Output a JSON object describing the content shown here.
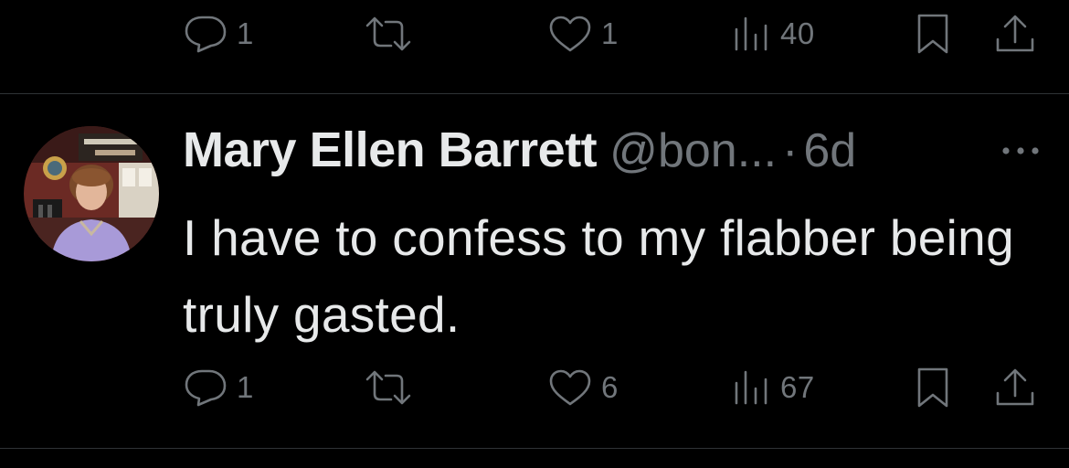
{
  "previous_tweet": {
    "actions": {
      "reply_count": "1",
      "retweet_count": "",
      "like_count": "1",
      "views_count": "40"
    }
  },
  "tweet": {
    "author": {
      "display_name": "Mary Ellen Barrett",
      "handle": "@bon...",
      "separator": "·",
      "timestamp": "6d"
    },
    "text": "I have to confess to my flabber being truly gasted.",
    "actions": {
      "reply_count": "1",
      "retweet_count": "",
      "like_count": "6",
      "views_count": "67"
    }
  },
  "theme": {
    "background": "#000000",
    "primary_text": "#e7e9ea",
    "secondary_text": "#71767b",
    "divider": "#2f3336"
  },
  "icons": [
    "reply-icon",
    "retweet-icon",
    "like-icon",
    "views-icon",
    "bookmark-icon",
    "share-icon",
    "more-icon"
  ]
}
